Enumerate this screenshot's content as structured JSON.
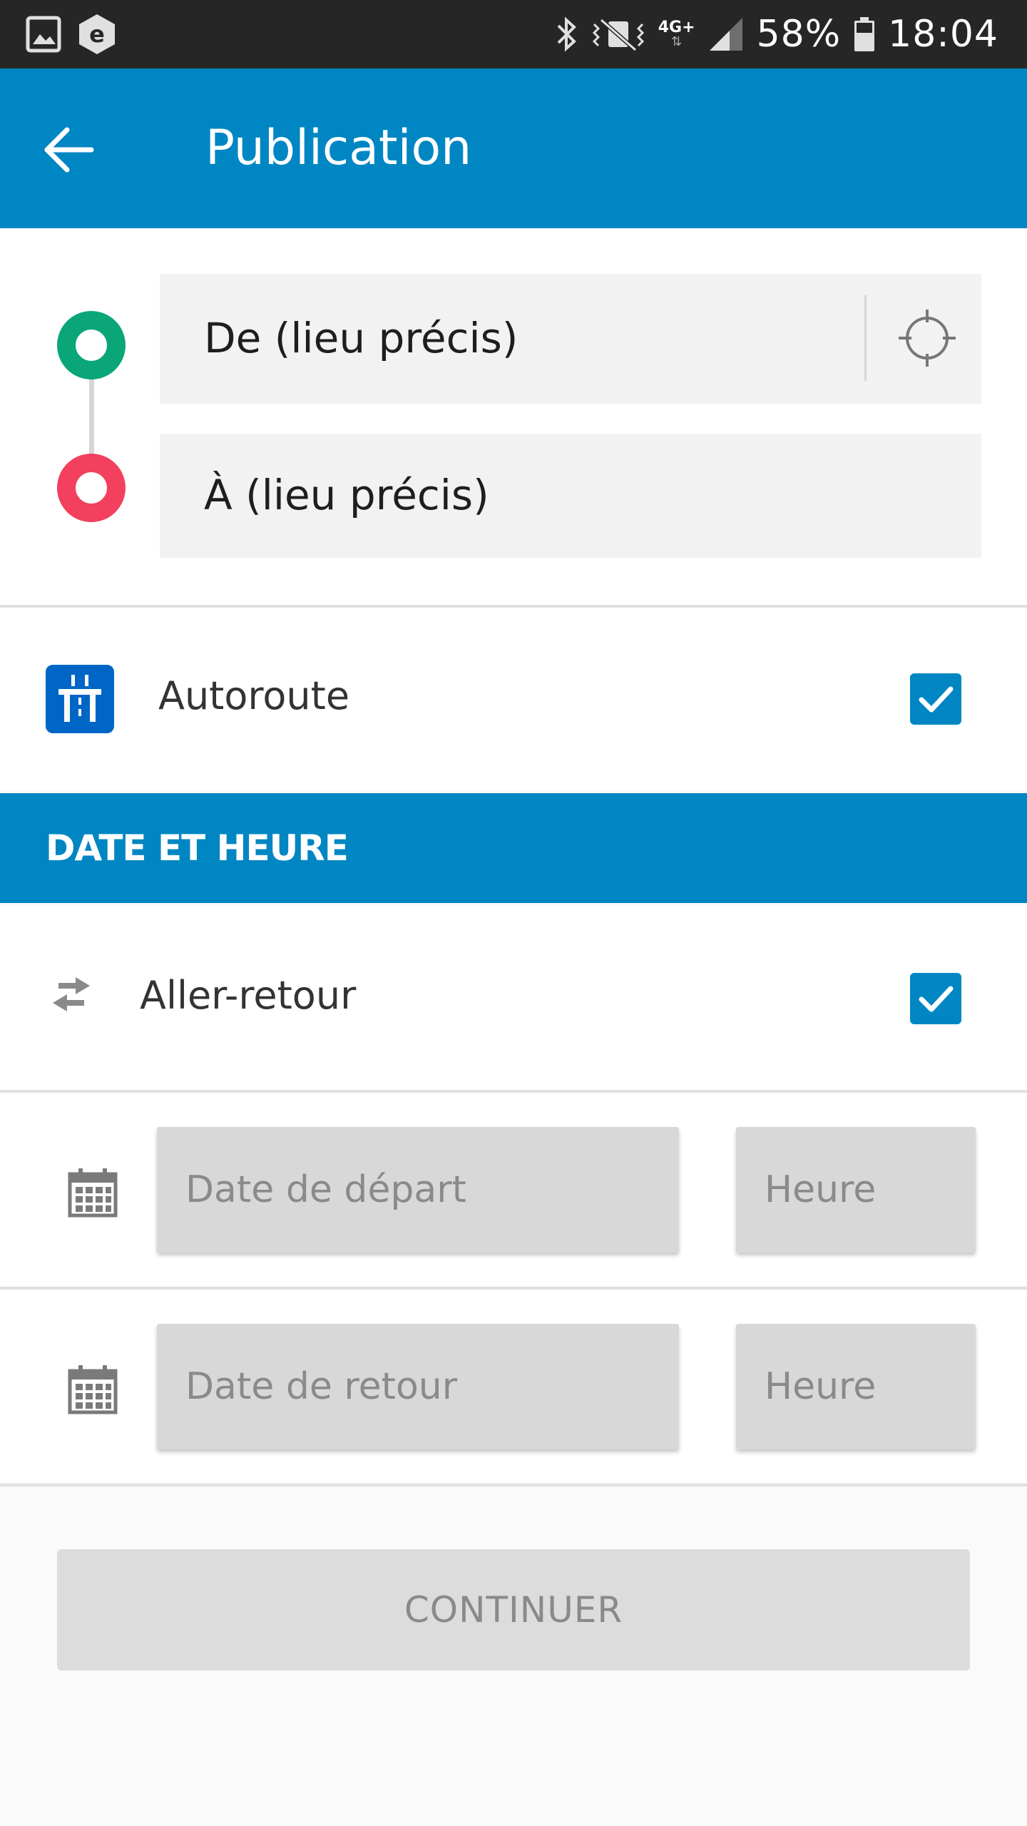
{
  "status_bar": {
    "battery_percent": "58%",
    "time": "18:04",
    "network": "4G+",
    "icons": [
      "gallery-icon",
      "e-icon",
      "bluetooth-icon",
      "vibrate-mute-icon",
      "signal-icon",
      "battery-icon"
    ]
  },
  "app_bar": {
    "title": "Publication",
    "back_icon": "arrow-left-icon"
  },
  "route": {
    "from_placeholder": "De (lieu précis)",
    "to_placeholder": "À (lieu précis)",
    "locate_icon": "crosshair-icon",
    "colors": {
      "from": "#0aa678",
      "to": "#f2405e"
    }
  },
  "highway": {
    "label": "Autoroute",
    "checked": true,
    "icon": "highway-icon"
  },
  "date_section": {
    "header": "DATE ET HEURE",
    "round_trip": {
      "label": "Aller-retour",
      "checked": true,
      "icon": "swap-arrows-icon"
    },
    "departure": {
      "date_placeholder": "Date de départ",
      "time_placeholder": "Heure"
    },
    "return": {
      "date_placeholder": "Date de retour",
      "time_placeholder": "Heure"
    }
  },
  "continue_button": {
    "label": "CONTINUER"
  },
  "theme": {
    "primary": "#0086c3",
    "statusbar": "#262626"
  }
}
